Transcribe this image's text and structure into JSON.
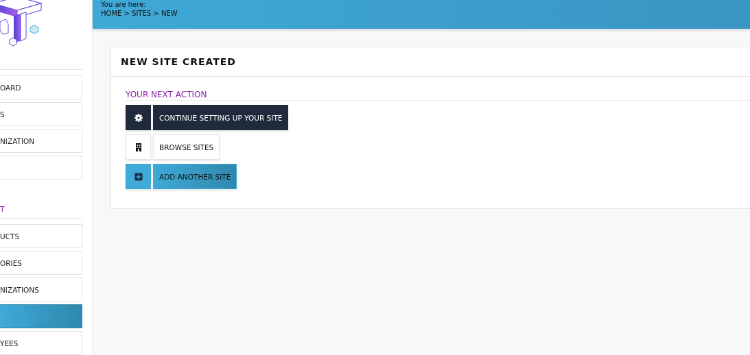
{
  "sidebar": {
    "items": [
      {
        "kind": "item",
        "label": "OARD",
        "selected": false
      },
      {
        "kind": "item",
        "label": "S",
        "selected": false
      },
      {
        "kind": "item",
        "label": "NIZATION",
        "selected": false
      },
      {
        "kind": "item",
        "selected": false
      },
      {
        "kind": "header",
        "label": "T"
      },
      {
        "kind": "item",
        "label": "UCTS",
        "selected": false
      },
      {
        "kind": "item",
        "label": "ORIES",
        "selected": false
      },
      {
        "kind": "item",
        "label": "NIZATIONS",
        "selected": false
      },
      {
        "kind": "item",
        "selected": true
      },
      {
        "kind": "item",
        "label": "YEES",
        "selected": false
      }
    ]
  },
  "breadcrumb": {
    "intro": "You are here:",
    "path": "HOME > SITES > NEW"
  },
  "card": {
    "title": "NEW SITE CREATED",
    "section": "YOUR NEXT ACTION",
    "actions": [
      {
        "label": "CONTINUE SETTING UP YOUR SITE"
      },
      {
        "label": "BROWSE SITES"
      },
      {
        "label": "ADD ANOTHER SITE"
      }
    ]
  }
}
